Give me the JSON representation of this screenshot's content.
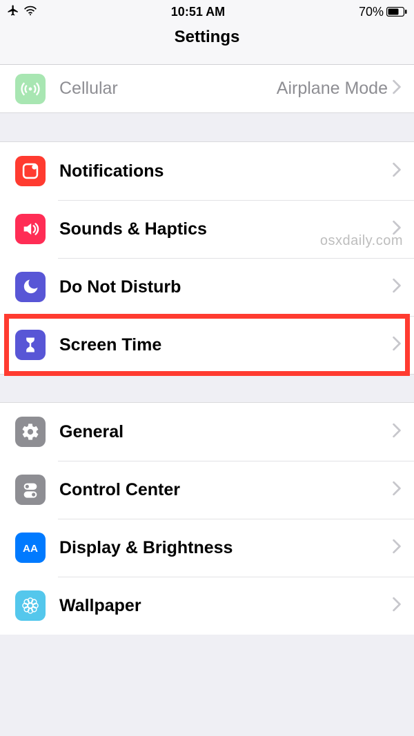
{
  "status": {
    "time": "10:51 AM",
    "battery_pct": "70%"
  },
  "header": {
    "title": "Settings"
  },
  "watermark": "osxdaily.com",
  "sections": {
    "top": {
      "cellular_label": "Cellular",
      "cellular_detail": "Airplane Mode"
    },
    "group1": {
      "notifications": "Notifications",
      "sounds": "Sounds & Haptics",
      "dnd": "Do Not Disturb",
      "screentime": "Screen Time"
    },
    "group2": {
      "general": "General",
      "controlcenter": "Control Center",
      "display": "Display & Brightness",
      "wallpaper": "Wallpaper"
    }
  },
  "icons": {
    "cellular": "cellular-icon",
    "notifications": "notifications-icon",
    "sounds": "sounds-icon",
    "dnd": "dnd-icon",
    "screentime": "screentime-icon",
    "general": "general-icon",
    "controlcenter": "controlcenter-icon",
    "display": "display-icon",
    "wallpaper": "wallpaper-icon"
  },
  "colors": {
    "notifications": "#ff3b30",
    "sounds": "#ff2d55",
    "dnd": "#5856d6",
    "screentime": "#5856d6",
    "general": "#8e8e93",
    "controlcenter": "#8e8e93",
    "display": "#007aff",
    "wallpaper": "#54c7ec",
    "cellular": "#a8e6b2"
  }
}
